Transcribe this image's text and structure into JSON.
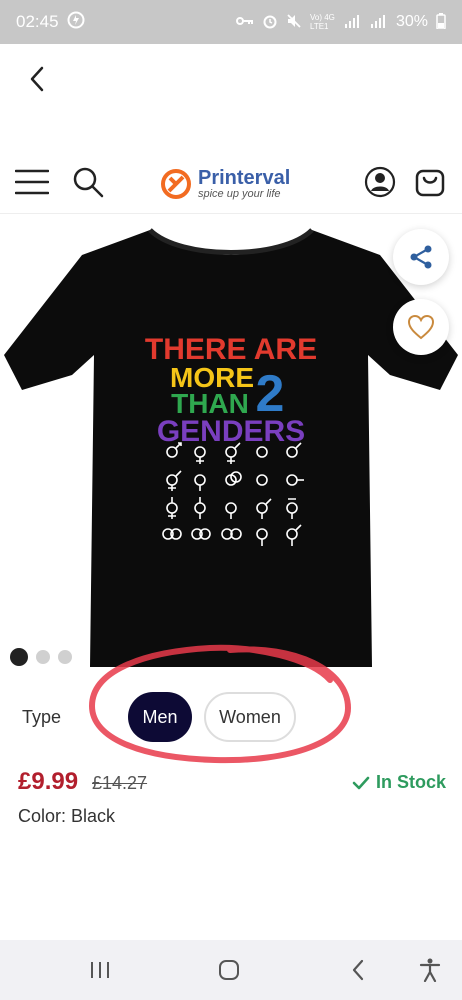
{
  "status_bar": {
    "time": "02:45",
    "network": "Vo) 4G LTE1",
    "battery": "30%"
  },
  "header": {
    "brand": "Printerval",
    "tagline": "spice up your life"
  },
  "product": {
    "shirt_text_lines": [
      "THERE ARE",
      "MORE",
      "THAN",
      "GENDERS"
    ],
    "shirt_number": "2",
    "image_dots": 3,
    "active_dot": 0
  },
  "type_selector": {
    "label": "Type",
    "options": [
      "Men",
      "Women"
    ],
    "selected": "Men"
  },
  "pricing": {
    "price": "£9.99",
    "old_price": "£14.27",
    "stock": "In Stock"
  },
  "color": {
    "label": "Color:",
    "value": "Black"
  },
  "colors": {
    "status_bar_bg": "#c7c7c7",
    "selected_option_bg": "#0d0a35",
    "price": "#b21f2d",
    "stock": "#2e9b5e",
    "annotation": "#e83a4a"
  }
}
